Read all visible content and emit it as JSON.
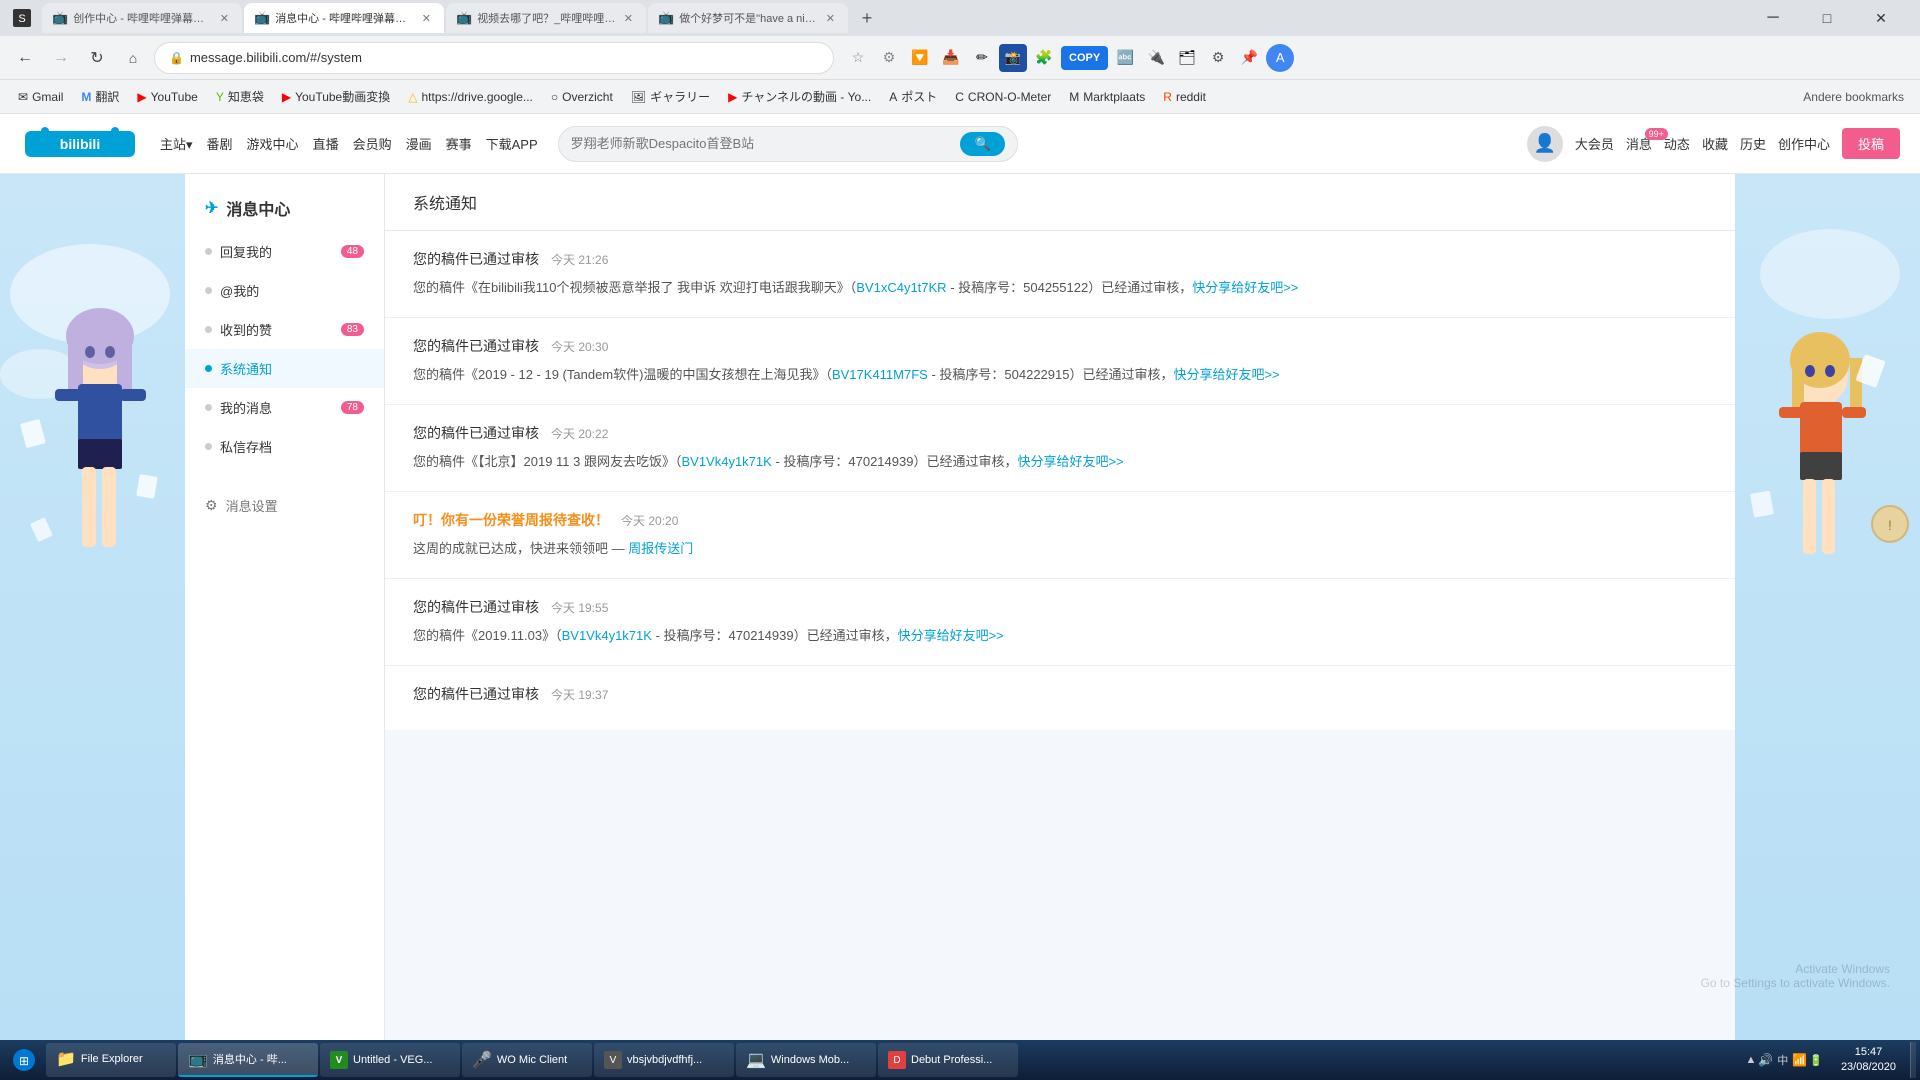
{
  "browser": {
    "tabs": [
      {
        "id": "tab1",
        "title": "创作中心 - 哔哩哔哩弹幕视频网",
        "favicon": "📺",
        "active": false
      },
      {
        "id": "tab2",
        "title": "消息中心 - 哔哩哔哩弹幕视频网",
        "favicon": "📺",
        "active": true
      },
      {
        "id": "tab3",
        "title": "视频去哪了吧？_哔哩哔哩（\"- \"）",
        "favicon": "📺",
        "active": false
      },
      {
        "id": "tab4",
        "title": "做个好梦可不是\"have a nice dre...",
        "favicon": "📺",
        "active": false
      }
    ],
    "url": "message.bilibili.com/#/system",
    "copy_label": "COPY"
  },
  "bookmarks": [
    {
      "label": "Gmail",
      "favicon": "✉"
    },
    {
      "label": "翻訳",
      "favicon": "M"
    },
    {
      "label": "YouTube",
      "favicon": "▶"
    },
    {
      "label": "知恵袋",
      "favicon": "Y"
    },
    {
      "label": "YouTube動画変換",
      "favicon": "▶"
    },
    {
      "label": "https://drive.google...",
      "favicon": "△"
    },
    {
      "label": "Overzicht",
      "favicon": "○"
    },
    {
      "label": "ギャラリー",
      "favicon": "G"
    },
    {
      "label": "チャンネルの動画 - Yo...",
      "favicon": "▶"
    },
    {
      "label": "ポスト",
      "favicon": "A"
    },
    {
      "label": "CRON-O-Meter",
      "favicon": "C"
    },
    {
      "label": "Marktplaats",
      "favicon": "M"
    },
    {
      "label": "reddit",
      "favicon": "R"
    },
    {
      "label": "Andere bookmarks",
      "favicon": "☆"
    }
  ],
  "bilibili": {
    "logo": "bilibili",
    "nav_items": [
      "主站▾",
      "番剧",
      "游戏中心",
      "直播",
      "会员购",
      "漫画",
      "赛事",
      "下载APP"
    ],
    "search_placeholder": "罗翔老师新歌Despacito首登B站",
    "header_right": {
      "avatar": "👤",
      "links": [
        "大会员",
        "消息",
        "动态",
        "收藏",
        "历史",
        "创作中心"
      ],
      "notification_badge": "99+",
      "post_btn": "投稿"
    }
  },
  "sidebar": {
    "title": "消息中心",
    "items": [
      {
        "label": "回复我的",
        "badge": "48",
        "active": false,
        "dot": true
      },
      {
        "label": "@我的",
        "badge": "",
        "active": false,
        "dot": true
      },
      {
        "label": "收到的赞",
        "badge": "83",
        "active": false,
        "dot": true
      },
      {
        "label": "系统通知",
        "badge": "",
        "active": true,
        "dot": true
      },
      {
        "label": "我的消息",
        "badge": "78",
        "active": false,
        "dot": true
      },
      {
        "label": "私信存档",
        "badge": "",
        "active": false,
        "dot": true
      }
    ],
    "settings": "消息设置"
  },
  "notifications": {
    "header": "系统通知",
    "items": [
      {
        "id": 1,
        "title": "您的稿件已通过审核",
        "time": "今天 21:26",
        "body_prefix": "您的稿件《在bilibili我110个视频被恶意举报了 我申诉 欢迎打电话跟我聊天》（",
        "link_text": "BV1xC4y1t7KR",
        "link_href": "#",
        "body_mid": " - 投稿序号：504255122）已经通过审核，",
        "action_link": "快分享给好友吧>>",
        "action_href": "#"
      },
      {
        "id": 2,
        "title": "您的稿件已通过审核",
        "time": "今天 20:30",
        "body_prefix": "您的稿件《2019 - 12 - 19 (Tandem软件)温暖的中国女孩想在上海见我》（",
        "link_text": "BV17K411M7FS",
        "link_href": "#",
        "body_mid": " - 投稿序号：504222915）已经通过审核，",
        "action_link": "快分享给好友吧>>",
        "action_href": "#"
      },
      {
        "id": 3,
        "title": "您的稿件已通过审核",
        "time": "今天 20:22",
        "body_prefix": "您的稿件《【北京】2019 11 3 跟网友去吃饭》（",
        "link_text": "BV1Vk4y1k71K",
        "link_href": "#",
        "body_mid": " - 投稿序号：470214939）已经通过审核，",
        "action_link": "快分享给好友吧>>",
        "action_href": "#"
      },
      {
        "id": 4,
        "title": "叮！你有一份荣誉周报待查收！",
        "time": "今天 20:20",
        "body_prefix": "这周的成就已达成，快进来领领吧 — ",
        "link_text": "周报传送门",
        "link_href": "#",
        "body_mid": "",
        "action_link": "",
        "action_href": "",
        "is_highlight": true
      },
      {
        "id": 5,
        "title": "您的稿件已通过审核",
        "time": "今天 19:55",
        "body_prefix": "您的稿件《2019.11.03》（",
        "link_text": "BV1Vk4y1k71K",
        "link_href": "#",
        "body_mid": " - 投稿序号：470214939）已经通过审核，",
        "action_link": "快分享给好友吧>>",
        "action_href": "#"
      },
      {
        "id": 6,
        "title": "您的稿件已通过审核",
        "time": "今天 19:37",
        "body_prefix": "",
        "link_text": "",
        "link_href": "#",
        "body_mid": "",
        "action_link": "",
        "action_href": ""
      }
    ]
  },
  "taskbar": {
    "start_icon": "⊞",
    "items": [
      {
        "label": "File Explorer",
        "icon": "📁"
      },
      {
        "label": "消息中心 - 哔...",
        "icon": "📺"
      },
      {
        "label": "Untitled - VEG...",
        "icon": "V"
      },
      {
        "label": "WO Mic Client",
        "icon": "🎤"
      },
      {
        "label": "vbsjvbdjvdfhfj...",
        "icon": "V"
      },
      {
        "label": "Windows Mob...",
        "icon": "W"
      },
      {
        "label": "Debut Professi...",
        "icon": "D"
      }
    ],
    "clock": {
      "time": "15:47",
      "date": "23/08/2020"
    },
    "sys_icons": [
      "🔊",
      "中",
      "⊞",
      "▲"
    ]
  },
  "win_activate": {
    "line1": "Activate Windows",
    "line2": "Go to Settings to activate Windows."
  }
}
